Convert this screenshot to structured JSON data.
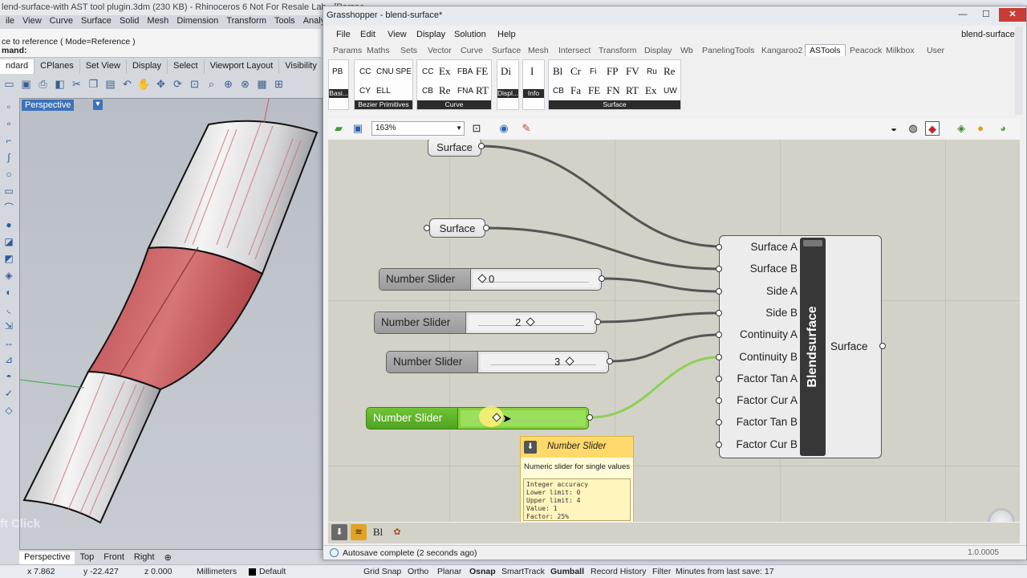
{
  "rhino": {
    "title": "lend-surface-with AST tool plugin.3dm (230 KB) - Rhinoceros 6 Not For Resale Lab - [Perspe",
    "menu": [
      "ile",
      "View",
      "Curve",
      "Surface",
      "Solid",
      "Mesh",
      "Dimension",
      "Transform",
      "Tools",
      "Analyz"
    ],
    "command_lines": [
      "ce to reference ( Mode=Reference )",
      "mand:"
    ],
    "tabs": [
      "ndard",
      "CPlanes",
      "Set View",
      "Display",
      "Select",
      "Viewport Layout",
      "Visibility"
    ],
    "viewport_label": "Perspective",
    "overlay_hint": "ft Click",
    "view_tabs": [
      "Perspective",
      "Top",
      "Front",
      "Right"
    ],
    "status": {
      "x": "x 7.862",
      "y": "y -22.427",
      "z": "z 0.000",
      "units": "Millimeters",
      "layer": "Default",
      "items": [
        "Grid Snap",
        "Ortho",
        "Planar",
        "Osnap",
        "SmartTrack",
        "Gumball",
        "Record History",
        "Filter",
        "Minutes from last save: 17"
      ]
    }
  },
  "gh": {
    "title": "Grasshopper - blend-surface*",
    "doc_name": "blend-surface*",
    "menu": [
      "File",
      "Edit",
      "View",
      "Display",
      "Solution",
      "Help"
    ],
    "tabs": [
      "Params",
      "Maths",
      "Sets",
      "Vector",
      "Curve",
      "Surface",
      "Mesh",
      "Intersect",
      "Transform",
      "Display",
      "Wb",
      "PanelingTools",
      "Kangaroo2",
      "ASTools",
      "Peacock",
      "Milkbox",
      "User"
    ],
    "active_tab": "ASTools",
    "ribbon": {
      "basic": {
        "btn": "PB",
        "caption": "Basi..."
      },
      "bezier": {
        "row1": [
          "CC",
          "CNU",
          "SPE"
        ],
        "row2": [
          "CY",
          "ELL"
        ],
        "caption": "Bezier Primitives"
      },
      "curve": {
        "row1": [
          "CC",
          "Ex",
          "FBA",
          "FE"
        ],
        "row2": [
          "CB",
          "Re",
          "FNA",
          "RT"
        ],
        "caption": "Curve"
      },
      "display": {
        "btn": "Di",
        "caption": "Displ..."
      },
      "info": {
        "btn": "I",
        "caption": "Info"
      },
      "surface": {
        "row1": [
          "Bl",
          "Cr",
          "Fi",
          "FP",
          "FV",
          "Ru",
          "Re"
        ],
        "row2": [
          "CB",
          "Fa",
          "FE",
          "FN",
          "RT",
          "Ex",
          "UW"
        ],
        "caption": "Surface"
      }
    },
    "zoom": "163%",
    "canvas": {
      "params": [
        "Surface",
        "Surface"
      ],
      "sliders": [
        {
          "label": "Number Slider",
          "value": "0"
        },
        {
          "label": "Number Slider",
          "value": "2"
        },
        {
          "label": "Number Slider",
          "value": "3"
        },
        {
          "label": "Number Slider",
          "value": ""
        }
      ],
      "component": {
        "name": "Blendsurface",
        "inputs": [
          "Surface A",
          "Surface B",
          "Side A",
          "Side B",
          "Continuity A",
          "Continuity B",
          "Factor Tan A",
          "Factor Cur A",
          "Factor Tan B",
          "Factor Cur B"
        ],
        "output": "Surface"
      },
      "tooltip": {
        "title": "Number Slider",
        "description": "Numeric slider for single values",
        "details": [
          "Integer accuracy",
          "Lower limit: 0",
          "Upper limit: 4",
          "Value: 1",
          "Factor: 25%"
        ]
      }
    },
    "bottom_bar": [
      "Bl"
    ],
    "status": "Autosave complete (2 seconds ago)",
    "version": "1.0.0005"
  },
  "colors": {
    "slider_active": "#86d140",
    "wire": "#555555",
    "wire_active": "#8fcf55",
    "surface_red": "#c25a5c"
  }
}
